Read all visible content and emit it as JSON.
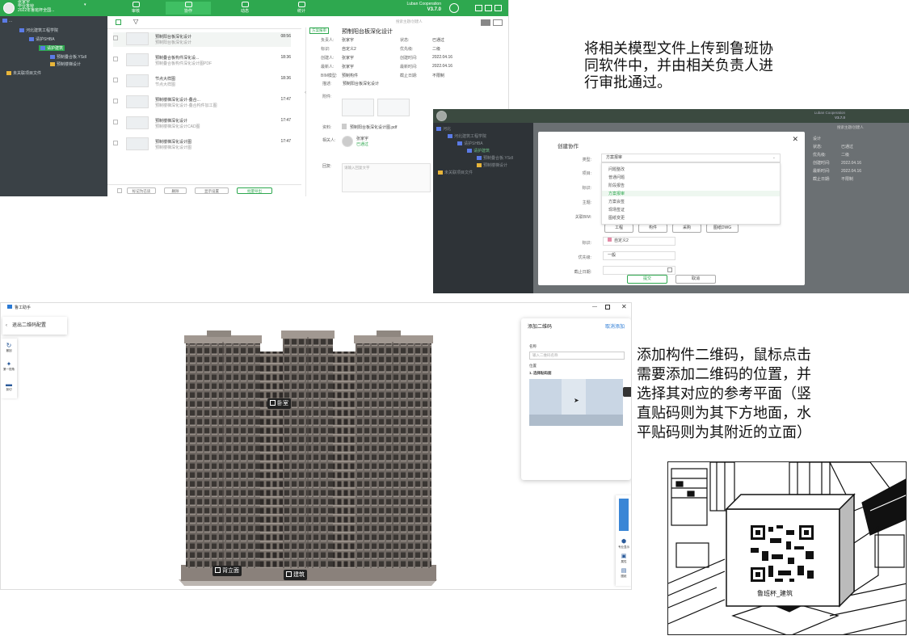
{
  "caption_top": [
    "将相关模型文件上传到鲁班协",
    "同软件中，并由相关负责人进",
    "行审批通过。"
  ],
  "caption_right": [
    "添加构件二维码，鼠标点击",
    "需要添加二维码的位置，并",
    "选择其对应的参考平面（竖",
    "直贴码则为其下方地面，水",
    "平贴码则为其附近的立面）"
  ],
  "collab_app": {
    "user_name": "张家宇",
    "user_line2": "毕业答辩",
    "project_line": "2022年鲁班杯全国...",
    "tabs": [
      "审核",
      "协作",
      "动态",
      "统计"
    ],
    "brand": "Luban Cooperation",
    "version": "V3.7.0",
    "search_placeholder": "搜索主题/创建人",
    "tree": [
      "...",
      "河北建筑工程学院",
      "请护SHBA",
      "请护建筑",
      "预制叠合板.YSdl",
      "预制楼梯设计",
      "未关联项目文件"
    ],
    "files": [
      {
        "title": "预制阳台板深化设计",
        "sub": "预制阳台板深化设计",
        "time": "08:56"
      },
      {
        "title": "预制叠合板构件深化设...",
        "sub": "预制叠合板构件深化设计图PDF",
        "time": "18:36"
      },
      {
        "title": "节点大样图",
        "sub": "节点大样图",
        "time": "18:36"
      },
      {
        "title": "预制楼梯深化设计-叠合...",
        "sub": "预制楼梯深化设计-叠合构件加工图",
        "time": "17:47"
      },
      {
        "title": "预制楼梯深化设计",
        "sub": "预制楼梯深化设计CAD图",
        "time": "17:47"
      },
      {
        "title": "预制楼梯深化设计图",
        "sub": "预制楼梯深化设计图",
        "time": "17:47"
      }
    ],
    "bottom": {
      "mark_done": "标记为已读",
      "delete": "删除",
      "display": "显示设置",
      "add_item": "批量导出"
    },
    "detail": {
      "tag": "方案报审",
      "title": "预制阳台板深化设计",
      "rows": [
        [
          "负责人:",
          "张家宇",
          "状态:",
          "已通过"
        ],
        [
          "标识:",
          "自定义2",
          "优先级:",
          "二级"
        ],
        [
          "创建人:",
          "张家宇",
          "创建时间:",
          "2022.04.16"
        ],
        [
          "最新人:",
          "张家宇",
          "最新时间:",
          "2022.04.16"
        ],
        [
          "BIM模型:",
          "预制构件",
          "截止日期:",
          "不限制"
        ]
      ],
      "desc_label": "描述:",
      "desc": "预制阳台板深化设计",
      "attach_label": "附件:",
      "file_label": "资料:",
      "file_name": "预制阳台板深化设计图.pdf",
      "related_label": "相关人:",
      "related_name": "张家宇",
      "related_status": "已通过",
      "reply_label": "回复:",
      "reply_placeholder": "请输入回复文字"
    }
  },
  "dialog": {
    "title": "创建协作",
    "labels": {
      "type": "类型:",
      "project": "项目:",
      "mark": "标识:",
      "subject": "主题:",
      "bim": "关联BIM:",
      "tag": "标识:",
      "priority": "优先级:",
      "deadline": "截止日期:"
    },
    "type_value": "方案报审",
    "options": [
      "问题整改",
      "普通问题",
      "阶段报告",
      "方案报审",
      "方案会签",
      "现场签证",
      "图纸变更"
    ],
    "selected_option": "方案报审",
    "bim_buttons": [
      "工程",
      "构件",
      "采购",
      "图纸DWG"
    ],
    "tag_value": "自定义2",
    "priority_value": "一般",
    "submit": "提交",
    "cancel": "取消",
    "bg": {
      "brand": "Luban Cooperation",
      "version": "V3.7.0",
      "search": "搜索主题/创建人",
      "tree": [
        "河北",
        "河北建筑工程学院",
        "请护SHBA",
        "请护建筑",
        "预制叠合板.YSdl",
        "预制楼梯设计",
        "未关联项目文件"
      ],
      "right_rows": [
        "设计",
        "状态:",
        "优先级:",
        "创建时间:",
        "最新时间:",
        "截止日期:"
      ],
      "right_vals": [
        "已通过",
        "二级",
        "2022.04.16",
        "2022.04.16",
        "不限制"
      ]
    }
  },
  "qr_app": {
    "window_title": "鲁工助手",
    "exit_button": "退出二维码配置",
    "left_tools": [
      {
        "icon": "↻",
        "label": "撤回"
      },
      {
        "icon": "✦",
        "label": "第一视角"
      },
      {
        "icon": "▬",
        "label": "剖切"
      }
    ],
    "tags": [
      "卧室",
      "背立面",
      "建筑"
    ],
    "panel": {
      "title": "添加二维码",
      "cancel": "取消添加",
      "name_label": "名称",
      "name_placeholder": "输入二维码名称",
      "position_label": "位置",
      "step": "1. 选择贴码面"
    },
    "right_tools": [
      {
        "icon": "⬢",
        "label": "专业显示"
      },
      {
        "icon": "▣",
        "label": "属性"
      },
      {
        "icon": "▤",
        "label": "图纸"
      }
    ]
  },
  "illustration": {
    "qr_caption": "鲁班杯_建筑"
  },
  "colors": {
    "brand_green": "#2ea84f",
    "dark_panel": "#3a4146",
    "link_blue": "#2a7ad5"
  }
}
